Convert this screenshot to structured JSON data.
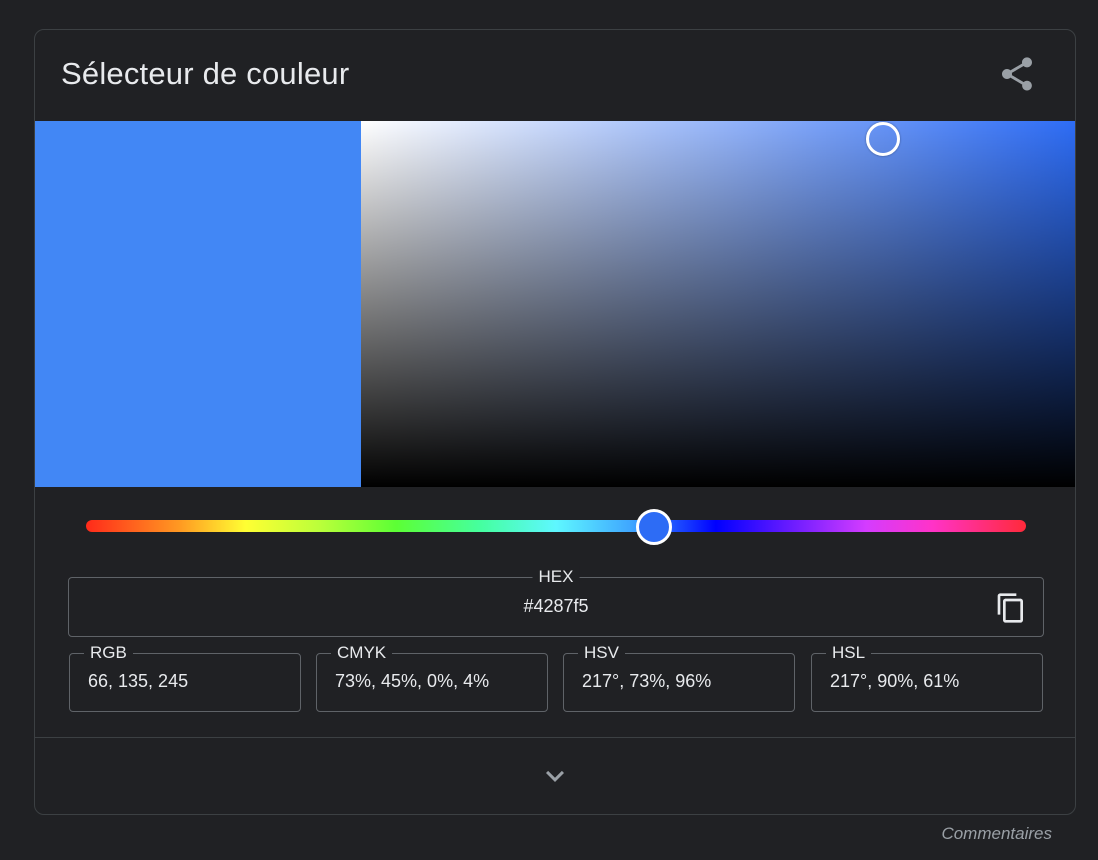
{
  "widget": {
    "title": "Sélecteur de couleur",
    "share_icon": "share-icon",
    "expand_icon": "chevron-down-icon",
    "copy_icon": "copy-icon"
  },
  "color": {
    "selected_hex_color": "#4287f5",
    "hue_color": "#2d6cf5",
    "hue_value": 217,
    "saturation": 73,
    "brightness": 96
  },
  "fields": {
    "hex": {
      "label": "HEX",
      "value": "#4287f5"
    },
    "rgb": {
      "label": "RGB",
      "value": "66, 135, 245"
    },
    "cmyk": {
      "label": "CMYK",
      "value": "73%, 45%, 0%, 4%"
    },
    "hsv": {
      "label": "HSV",
      "value": "217°, 73%, 96%"
    },
    "hsl": {
      "label": "HSL",
      "value": "217°, 90%, 61%"
    }
  },
  "footer": {
    "feedback_label": "Commentaires"
  }
}
